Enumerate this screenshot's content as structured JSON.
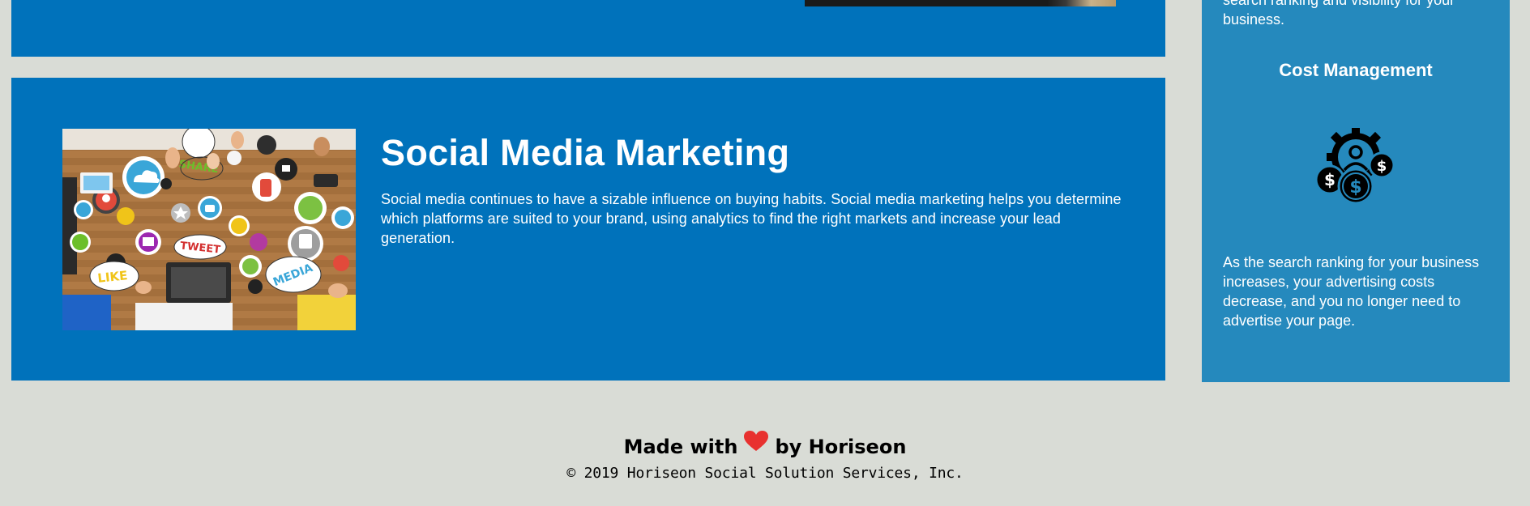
{
  "services": {
    "social_media": {
      "title": "Social Media Marketing",
      "body": "Social media continues to have a sizable influence on buying habits. Social media marketing helps you determine which platforms are suited to your brand, using analytics to find the right markets and increase your lead generation.",
      "image_labels": {
        "share": "SHARE",
        "tweet": "TWEET",
        "like": "LIKE",
        "media": "MEDIA"
      }
    }
  },
  "aside": {
    "previous_text_fragment": "search ranking and visibility for your business.",
    "cost_management": {
      "title": "Cost Management",
      "icon": "cost-management-gear-dollar-icon",
      "body": "As the search ranking for your business increases, your advertising costs decrease, and you no longer need to advertise your page."
    }
  },
  "footer": {
    "made_with": "Made with",
    "by": "by Horiseon",
    "heart_icon": "heart-icon",
    "heart_color": "#e8312f",
    "copyright": "© 2019 Horiseon Social Solution Services, Inc."
  },
  "colors": {
    "page_background": "#d9dcd6",
    "card_blue": "#0072bb",
    "aside_blue": "#2589bd"
  }
}
